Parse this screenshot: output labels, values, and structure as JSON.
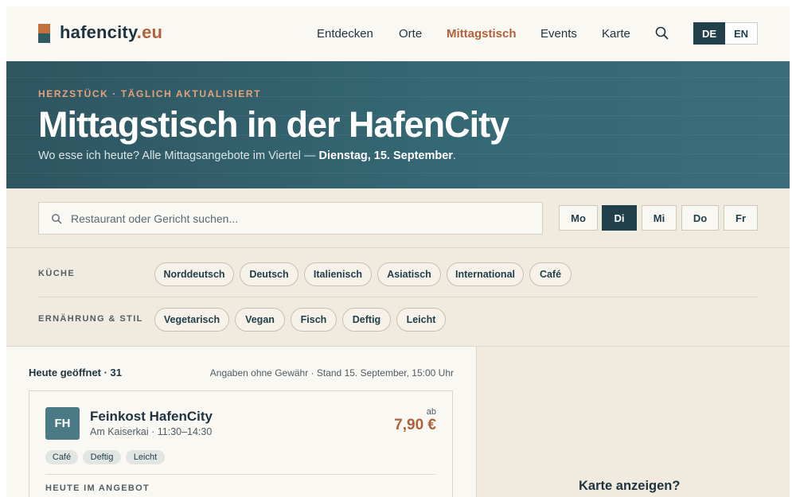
{
  "logo": {
    "name": "hafencity",
    "tld": ".eu"
  },
  "nav": [
    "Entdecken",
    "Orte",
    "Mittagstisch",
    "Events",
    "Karte"
  ],
  "nav_active": "Mittagstisch",
  "lang": {
    "de": "DE",
    "en": "EN",
    "active": "DE"
  },
  "hero": {
    "kicker": "HERZSTÜCK · TÄGLICH AKTUALISIERT",
    "title": "Mittagstisch in der HafenCity",
    "subtitle_prefix": "Wo esse ich heute? Alle Mittagsangebote im Viertel — ",
    "subtitle_date": "Dienstag, 15. September",
    "subtitle_suffix": "."
  },
  "search": {
    "placeholder": "Restaurant oder Gericht suchen..."
  },
  "days": [
    "Mo",
    "Di",
    "Mi",
    "Do",
    "Fr"
  ],
  "day_active": "Di",
  "filters": {
    "cuisine_label": "KÜCHE",
    "cuisine": [
      "Norddeutsch",
      "Deutsch",
      "Italienisch",
      "Asiatisch",
      "International",
      "Café"
    ],
    "diet_label": "ERNÄHRUNG & STIL",
    "diet": [
      "Vegetarisch",
      "Vegan",
      "Fisch",
      "Deftig",
      "Leicht"
    ]
  },
  "results": {
    "count_label": "Heute geöffnet · 31",
    "stand": "Angaben ohne Gewähr · Stand 15. September, 15:00 Uhr"
  },
  "restaurant": {
    "initials": "FH",
    "name": "Feinkost HafenCity",
    "meta": "Am Kaiserkai · 11:30–14:30",
    "price_prefix": "ab",
    "price": "7,90 €",
    "tags": [
      "Café",
      "Deftig",
      "Leicht"
    ],
    "offer_label": "HEUTE IM ANGEBOT"
  },
  "map": {
    "prompt": "Karte anzeigen?"
  },
  "colors": {
    "accent": "#b3603a",
    "dark": "#22404b",
    "hero": "#346874",
    "background": "#f1ebdf"
  }
}
